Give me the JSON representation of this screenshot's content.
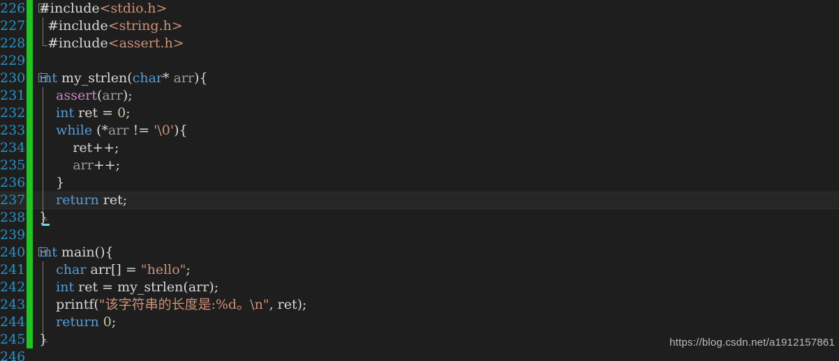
{
  "editor": {
    "theme": "dark",
    "background_color": "#1e1e1e",
    "current_line_color": "#262626",
    "line_number_color": "#2b91c4",
    "change_bar_color": "#21c521",
    "caret_color": "#7fd3e0",
    "first_line": 226,
    "last_line": 246,
    "current_line": 237
  },
  "watermark": {
    "text": "https://blog.csdn.net/a1912157861"
  },
  "lines": [
    {
      "number": "226",
      "changed": true,
      "fold": "box",
      "current": false,
      "tokens": [
        {
          "t": "#include",
          "c": "pp"
        },
        {
          "t": "<stdio.h>",
          "c": "hdr"
        }
      ]
    },
    {
      "number": "227",
      "changed": true,
      "fold": "line",
      "current": false,
      "tokens": [
        {
          "t": "  ",
          "c": "punct"
        },
        {
          "t": "#include",
          "c": "pp"
        },
        {
          "t": "<string.h>",
          "c": "hdr"
        }
      ]
    },
    {
      "number": "228",
      "changed": true,
      "fold": "end",
      "current": false,
      "tokens": [
        {
          "t": "  ",
          "c": "punct"
        },
        {
          "t": "#include",
          "c": "pp"
        },
        {
          "t": "<assert.h>",
          "c": "hdr"
        }
      ]
    },
    {
      "number": "229",
      "changed": true,
      "fold": "none",
      "current": false,
      "tokens": []
    },
    {
      "number": "230",
      "changed": true,
      "fold": "box",
      "current": false,
      "tokens": [
        {
          "t": "int",
          "c": "kw"
        },
        {
          "t": " ",
          "c": "punct"
        },
        {
          "t": "my_strlen",
          "c": "fn"
        },
        {
          "t": "(",
          "c": "punct"
        },
        {
          "t": "char",
          "c": "kw"
        },
        {
          "t": "* ",
          "c": "punct"
        },
        {
          "t": "arr",
          "c": "var"
        },
        {
          "t": "){",
          "c": "punct"
        }
      ]
    },
    {
      "number": "231",
      "changed": true,
      "fold": "line",
      "current": false,
      "tokens": [
        {
          "t": "    ",
          "c": "punct"
        },
        {
          "t": "assert",
          "c": "macro"
        },
        {
          "t": "(",
          "c": "punct"
        },
        {
          "t": "arr",
          "c": "var"
        },
        {
          "t": ");",
          "c": "punct"
        }
      ]
    },
    {
      "number": "232",
      "changed": true,
      "fold": "line",
      "current": false,
      "tokens": [
        {
          "t": "    ",
          "c": "punct"
        },
        {
          "t": "int",
          "c": "kw"
        },
        {
          "t": " ",
          "c": "punct"
        },
        {
          "t": "ret",
          "c": "id"
        },
        {
          "t": " = ",
          "c": "punct"
        },
        {
          "t": "0",
          "c": "num"
        },
        {
          "t": ";",
          "c": "punct"
        }
      ]
    },
    {
      "number": "233",
      "changed": true,
      "fold": "line",
      "current": false,
      "tokens": [
        {
          "t": "    ",
          "c": "punct"
        },
        {
          "t": "while",
          "c": "kw"
        },
        {
          "t": " (*",
          "c": "punct"
        },
        {
          "t": "arr",
          "c": "var"
        },
        {
          "t": " != ",
          "c": "punct"
        },
        {
          "t": "'\\0'",
          "c": "str"
        },
        {
          "t": "){",
          "c": "punct"
        }
      ]
    },
    {
      "number": "234",
      "changed": true,
      "fold": "line",
      "current": false,
      "tokens": [
        {
          "t": "        ",
          "c": "punct"
        },
        {
          "t": "ret",
          "c": "id"
        },
        {
          "t": "++;",
          "c": "punct"
        }
      ]
    },
    {
      "number": "235",
      "changed": true,
      "fold": "line",
      "current": false,
      "tokens": [
        {
          "t": "        ",
          "c": "punct"
        },
        {
          "t": "arr",
          "c": "var"
        },
        {
          "t": "++;",
          "c": "punct"
        }
      ]
    },
    {
      "number": "236",
      "changed": true,
      "fold": "line",
      "current": false,
      "tokens": [
        {
          "t": "    }",
          "c": "punct"
        }
      ]
    },
    {
      "number": "237",
      "changed": true,
      "fold": "line",
      "current": true,
      "tokens": [
        {
          "t": "    ",
          "c": "punct"
        },
        {
          "t": "return",
          "c": "kw"
        },
        {
          "t": " ",
          "c": "punct"
        },
        {
          "t": "ret",
          "c": "id"
        },
        {
          "t": ";",
          "c": "punct"
        }
      ]
    },
    {
      "number": "238",
      "changed": true,
      "fold": "end",
      "current": false,
      "tokens": [
        {
          "t": "}",
          "c": "punct"
        }
      ]
    },
    {
      "number": "239",
      "changed": true,
      "fold": "none",
      "current": false,
      "tokens": []
    },
    {
      "number": "240",
      "changed": true,
      "fold": "box",
      "current": false,
      "tokens": [
        {
          "t": "int",
          "c": "kw"
        },
        {
          "t": " ",
          "c": "punct"
        },
        {
          "t": "main",
          "c": "fn"
        },
        {
          "t": "(){",
          "c": "punct"
        }
      ]
    },
    {
      "number": "241",
      "changed": true,
      "fold": "line",
      "current": false,
      "tokens": [
        {
          "t": "    ",
          "c": "punct"
        },
        {
          "t": "char",
          "c": "kw"
        },
        {
          "t": " ",
          "c": "punct"
        },
        {
          "t": "arr",
          "c": "id"
        },
        {
          "t": "[] = ",
          "c": "punct"
        },
        {
          "t": "\"hello\"",
          "c": "str"
        },
        {
          "t": ";",
          "c": "punct"
        }
      ]
    },
    {
      "number": "242",
      "changed": true,
      "fold": "line",
      "current": false,
      "tokens": [
        {
          "t": "    ",
          "c": "punct"
        },
        {
          "t": "int",
          "c": "kw"
        },
        {
          "t": " ",
          "c": "punct"
        },
        {
          "t": "ret",
          "c": "id"
        },
        {
          "t": " = ",
          "c": "punct"
        },
        {
          "t": "my_strlen",
          "c": "fn"
        },
        {
          "t": "(",
          "c": "punct"
        },
        {
          "t": "arr",
          "c": "id"
        },
        {
          "t": ");",
          "c": "punct"
        }
      ]
    },
    {
      "number": "243",
      "changed": true,
      "fold": "line",
      "current": false,
      "tokens": [
        {
          "t": "    ",
          "c": "punct"
        },
        {
          "t": "printf",
          "c": "fn"
        },
        {
          "t": "(",
          "c": "punct"
        },
        {
          "t": "\"该字符串的长度是:%d。\\n\"",
          "c": "str"
        },
        {
          "t": ", ",
          "c": "punct"
        },
        {
          "t": "ret",
          "c": "id"
        },
        {
          "t": ");",
          "c": "punct"
        }
      ]
    },
    {
      "number": "244",
      "changed": true,
      "fold": "line",
      "current": false,
      "tokens": [
        {
          "t": "    ",
          "c": "punct"
        },
        {
          "t": "return",
          "c": "kw"
        },
        {
          "t": " ",
          "c": "punct"
        },
        {
          "t": "0",
          "c": "num"
        },
        {
          "t": ";",
          "c": "punct"
        }
      ]
    },
    {
      "number": "245",
      "changed": true,
      "fold": "end",
      "current": false,
      "tokens": [
        {
          "t": "}",
          "c": "punct"
        }
      ]
    },
    {
      "number": "246",
      "changed": false,
      "fold": "none",
      "current": false,
      "tokens": []
    }
  ]
}
